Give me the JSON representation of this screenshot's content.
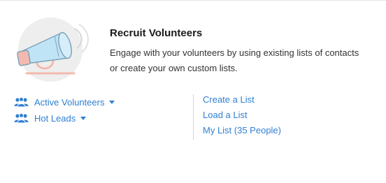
{
  "header": {
    "title": "Recruit Volunteers",
    "description": "Engage with your volunteers by using existing lists of contacts or create your own custom lists."
  },
  "segments": [
    {
      "label": "Active Volunteers",
      "icon": "people-icon"
    },
    {
      "label": "Hot Leads",
      "icon": "people-icon"
    }
  ],
  "actions": {
    "create": "Create a List",
    "load": "Load a List",
    "my_list": "My List (35 People)"
  },
  "colors": {
    "link": "#2f7fd2",
    "icon_circle": "#eeeeee",
    "megaphone": "#bfe4f6",
    "megaphone_outline": "#7fa3b8",
    "accent": "#f4b9ae"
  }
}
